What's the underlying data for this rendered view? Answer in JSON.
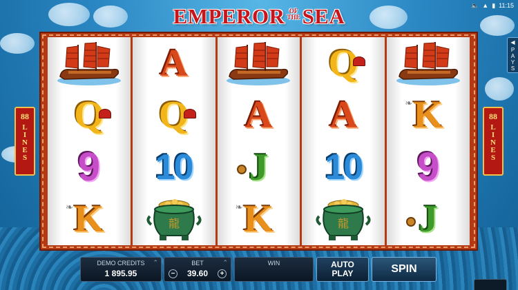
{
  "game": {
    "title_part1": "EMPEROR",
    "title_small_1": "OF",
    "title_small_2": "THE",
    "title_part2": "SEA"
  },
  "status": {
    "time": "11:15",
    "sound_icon": "speaker-icon",
    "wifi_icon": "wifi-icon",
    "battery_icon": "battery-icon"
  },
  "side_badges": {
    "left": {
      "number": "88",
      "word": "LINES"
    },
    "right": {
      "number": "88",
      "word": "LINES"
    }
  },
  "pays_tab": {
    "label": "PAYS"
  },
  "reels": [
    [
      "ship",
      "Q",
      "9",
      "K"
    ],
    [
      "A",
      "Q",
      "10",
      "pot"
    ],
    [
      "ship",
      "A",
      "J",
      "K"
    ],
    [
      "Q",
      "A",
      "10",
      "pot"
    ],
    [
      "ship",
      "K",
      "9",
      "J"
    ]
  ],
  "symbol_text": {
    "A": "A",
    "Q": "Q",
    "K": "K",
    "J": "J",
    "9": "9",
    "10": "10"
  },
  "controls": {
    "credits_label": "DEMO CREDITS",
    "credits_value": "1 895.95",
    "bet_label": "BET",
    "bet_value": "39.60",
    "bet_minus": "−",
    "bet_plus": "+",
    "win_label": "WIN",
    "win_value": "",
    "autoplay_line1": "AUTO",
    "autoplay_line2": "PLAY",
    "spin_label": "SPIN"
  },
  "colors": {
    "title_red": "#c8151b",
    "frame": "#b53a14",
    "badge_red": "#b31912",
    "badge_gold": "#f2c14a"
  }
}
